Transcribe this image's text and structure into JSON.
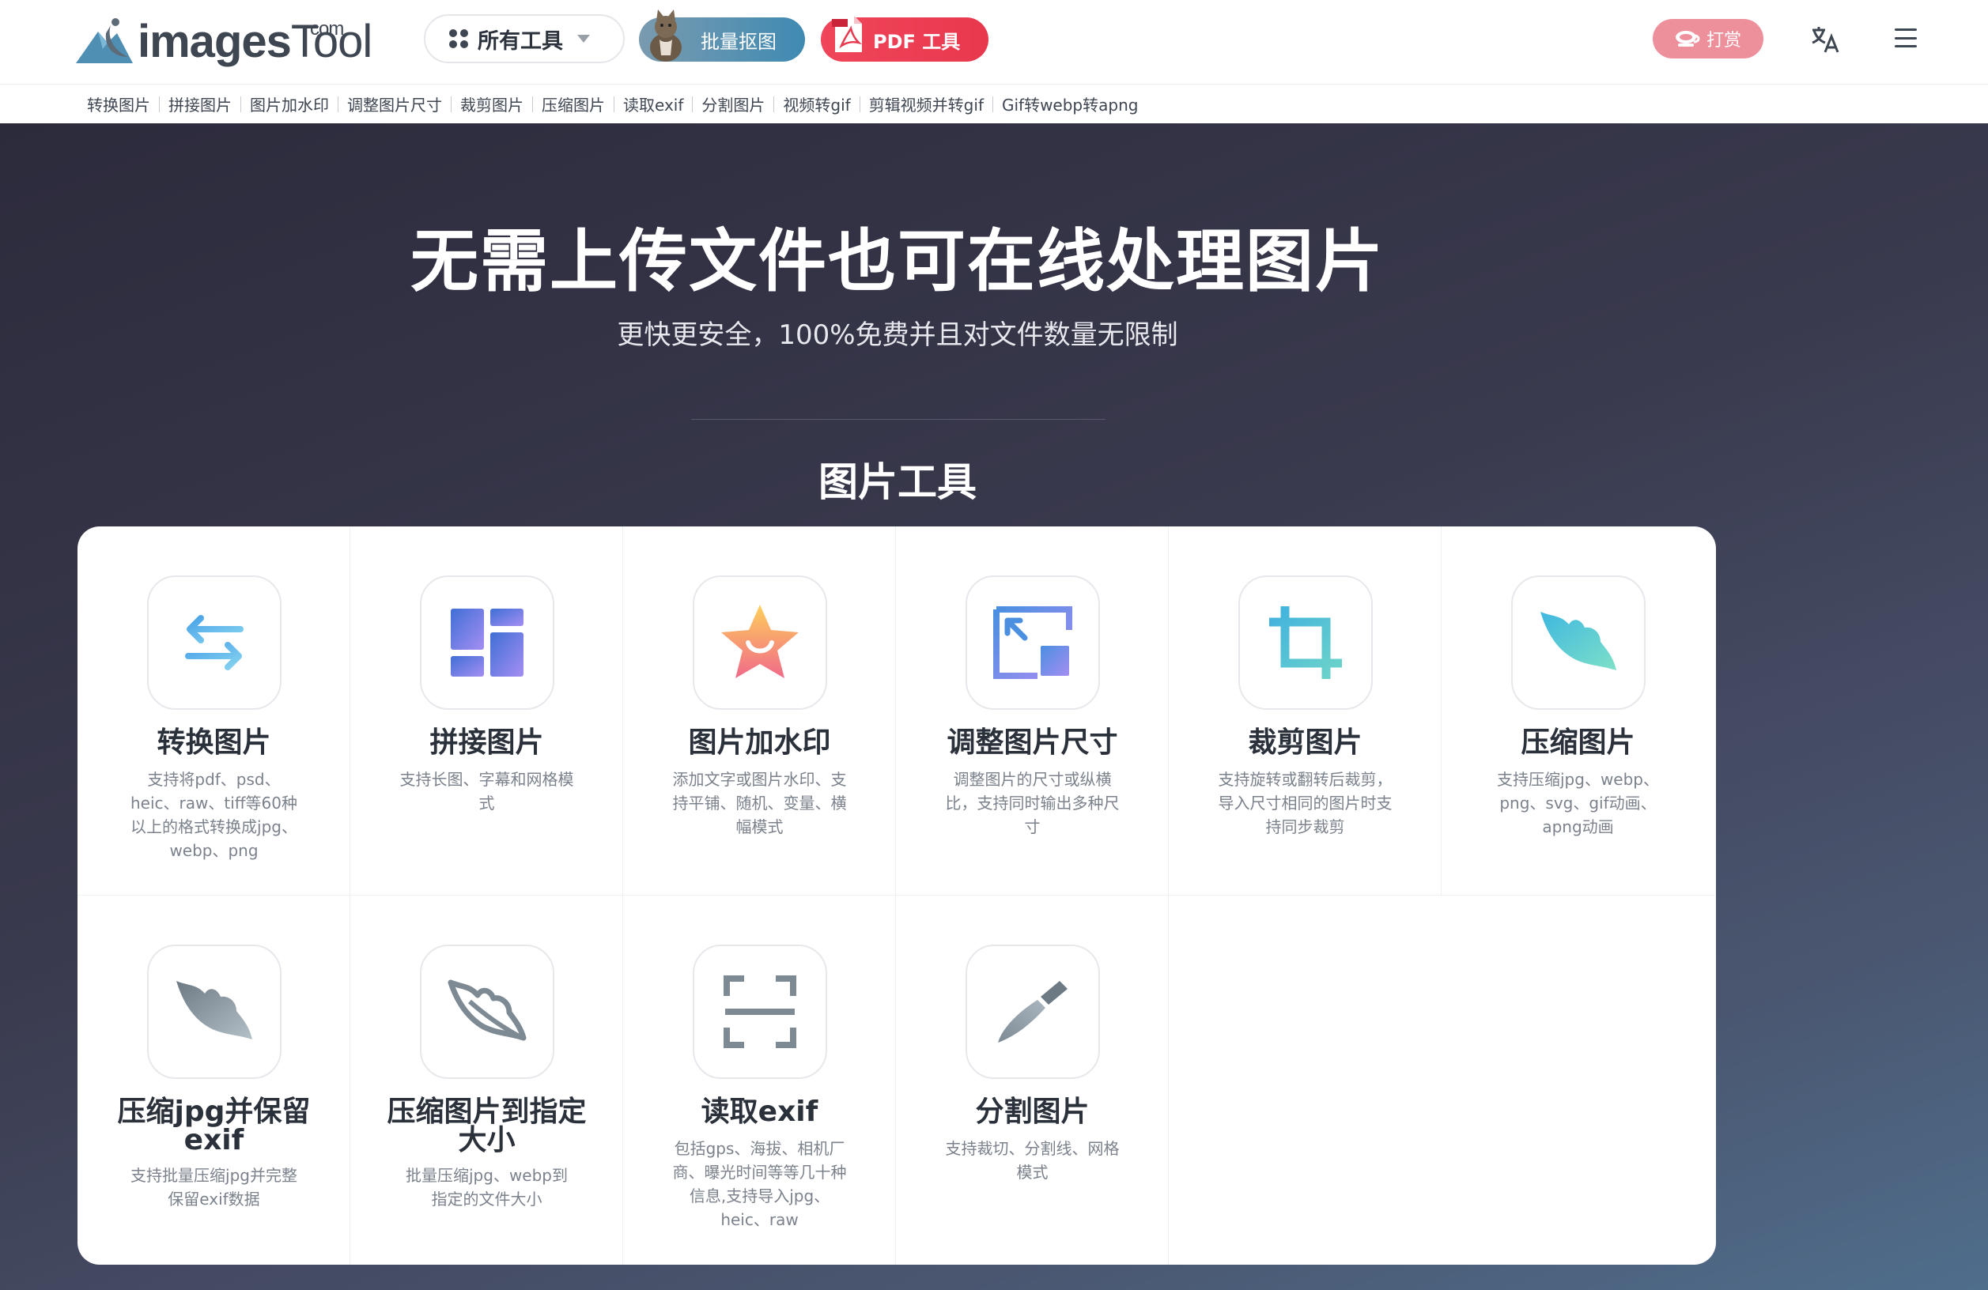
{
  "header": {
    "logo": {
      "brand": "images",
      "brand2": "Tool",
      "suffix": "com"
    },
    "all_tools_label": "所有工具",
    "batch_label": "批量抠图",
    "pdf_label": "PDF 工具",
    "reward_label": "打赏"
  },
  "nav": {
    "items": [
      "转换图片",
      "拼接图片",
      "图片加水印",
      "调整图片尺寸",
      "裁剪图片",
      "压缩图片",
      "读取exif",
      "分割图片",
      "视频转gif",
      "剪辑视频并转gif",
      "Gif转webp转apng"
    ]
  },
  "hero": {
    "title": "无需上传文件也可在线处理图片",
    "subtitle": "更快更安全，100%免费并且对文件数量无限制",
    "section_title": "图片工具"
  },
  "tools": [
    {
      "title": "转换图片",
      "desc": "支持将pdf、psd、heic、raw、tiff等60种以上的格式转换成jpg、webp、png",
      "icon": "swap-arrows-icon"
    },
    {
      "title": "拼接图片",
      "desc": "支持长图、字幕和网格模式",
      "icon": "grid-layout-icon"
    },
    {
      "title": "图片加水印",
      "desc": "添加文字或图片水印、支持平铺、随机、变量、横幅模式",
      "icon": "star-icon"
    },
    {
      "title": "调整图片尺寸",
      "desc": "调整图片的尺寸或纵横比，支持同时输出多种尺寸",
      "icon": "resize-icon"
    },
    {
      "title": "裁剪图片",
      "desc": "支持旋转或翻转后裁剪，导入尺寸相同的图片时支持同步裁剪",
      "icon": "crop-icon"
    },
    {
      "title": "压缩图片",
      "desc": "支持压缩jpg、webp、png、svg、gif动画、apng动画",
      "icon": "leaf-icon"
    },
    {
      "title": "压缩jpg并保留exif",
      "desc": "支持批量压缩jpg并完整保留exif数据",
      "icon": "leaf-gray-icon"
    },
    {
      "title": "压缩图片到指定大小",
      "desc": "批量压缩jpg、webp到指定的文件大小",
      "icon": "leaf-outline-icon"
    },
    {
      "title": "读取exif",
      "desc": "包括gps、海拔、相机厂商、曝光时间等等几十种信息,支持导入jpg、heic、raw",
      "icon": "scan-icon"
    },
    {
      "title": "分割图片",
      "desc": "支持裁切、分割线、网格模式",
      "icon": "knife-icon"
    }
  ],
  "colors": {
    "accent_blue": "#5aa7e0",
    "accent_purple": "#9f8df0",
    "pdf_red": "#e8384e",
    "reward_pink": "#ee8f9c"
  }
}
